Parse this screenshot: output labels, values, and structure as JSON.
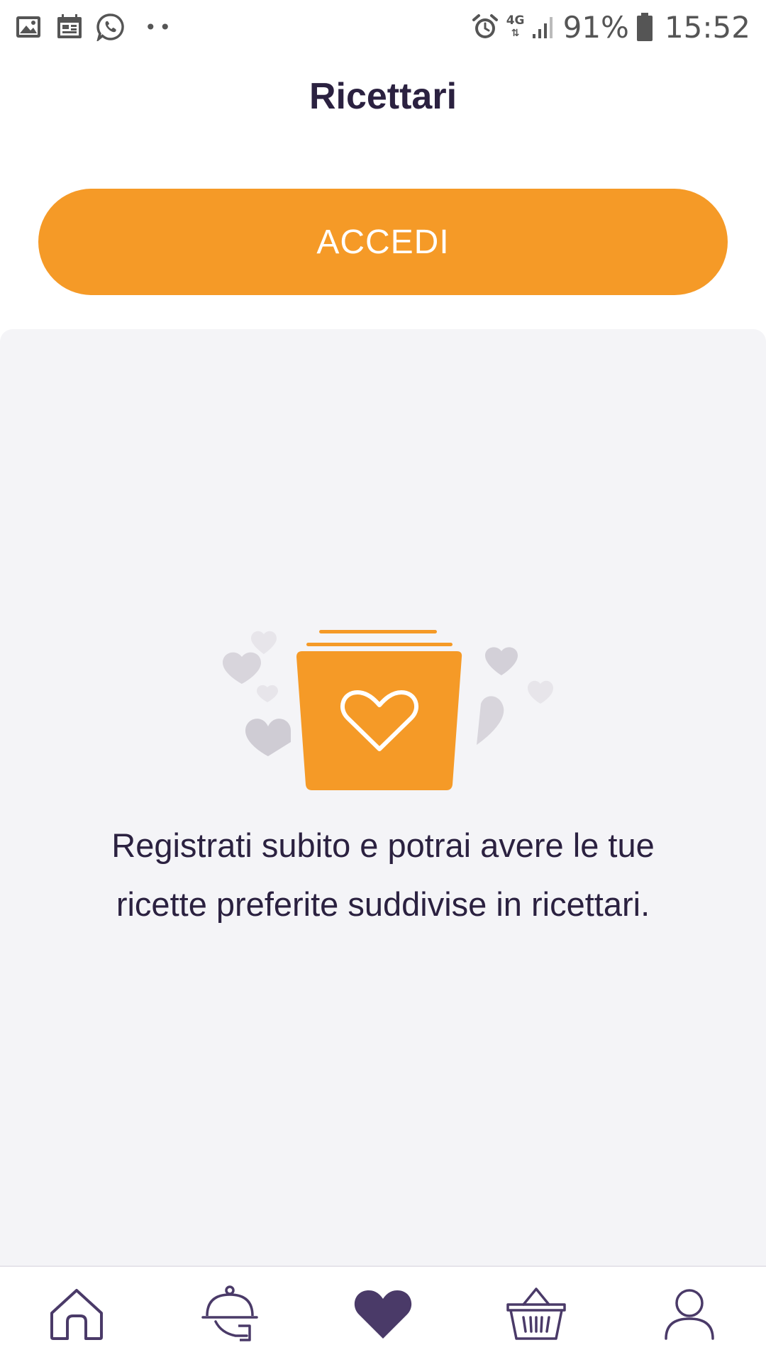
{
  "status_bar": {
    "network": "4G",
    "battery": "91%",
    "time": "15:52",
    "left_icons": [
      "gallery-icon",
      "calendar-icon",
      "whatsapp-icon",
      "more-notifications-icon"
    ],
    "right_icons": [
      "alarm-icon",
      "network-4g-icon",
      "signal-icon",
      "battery-icon"
    ]
  },
  "header": {
    "title": "Ricettari"
  },
  "login_button": {
    "label": "ACCEDI"
  },
  "empty_state": {
    "illustration": "recipe-folder-hearts-illustration",
    "message": "Registrati subito e potrai avere le tue ricette preferite suddivise in ricettari."
  },
  "bottom_nav": {
    "items": [
      {
        "icon": "home-icon",
        "active": false
      },
      {
        "icon": "cloche-icon",
        "active": false
      },
      {
        "icon": "heart-icon",
        "active": true
      },
      {
        "icon": "basket-icon",
        "active": false
      },
      {
        "icon": "user-icon",
        "active": false
      }
    ]
  },
  "colors": {
    "accent": "#f59a27",
    "primary_dark": "#2b2140",
    "nav_icon": "#4a3a68",
    "nav_active": "#4a3a68",
    "panel_bg": "#f4f4f7",
    "heart_grey": "#d6d3dc"
  }
}
